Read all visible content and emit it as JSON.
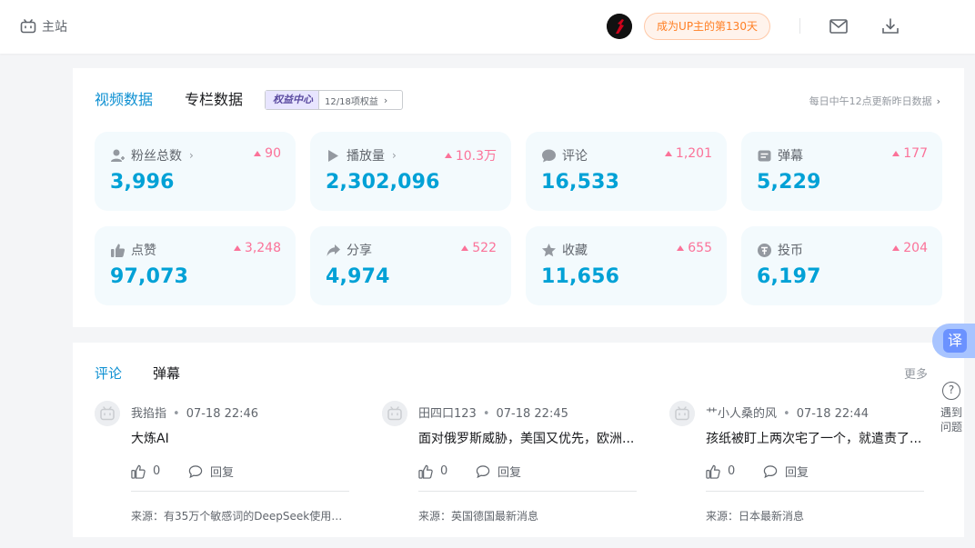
{
  "topbar": {
    "home_label": "主站",
    "up_badge": "成为UP主的第130天"
  },
  "data_panel": {
    "tabs": [
      "视频数据",
      "专栏数据"
    ],
    "equity": {
      "title": "权益中心",
      "progress": "12/18项权益"
    },
    "update_note": "每日中午12点更新昨日数据",
    "cards": [
      {
        "label": "粉丝总数",
        "value": "3,996",
        "delta": "90",
        "icon": "fans-icon",
        "has_chevron": true
      },
      {
        "label": "播放量",
        "value": "2,302,096",
        "delta": "10.3万",
        "icon": "play-icon",
        "has_chevron": true
      },
      {
        "label": "评论",
        "value": "16,533",
        "delta": "1,201",
        "icon": "comment-icon",
        "has_chevron": false
      },
      {
        "label": "弹幕",
        "value": "5,229",
        "delta": "177",
        "icon": "danmaku-icon",
        "has_chevron": false
      },
      {
        "label": "点赞",
        "value": "97,073",
        "delta": "3,248",
        "icon": "thumb-up-icon",
        "has_chevron": false
      },
      {
        "label": "分享",
        "value": "4,974",
        "delta": "522",
        "icon": "share-icon",
        "has_chevron": false
      },
      {
        "label": "收藏",
        "value": "11,656",
        "delta": "655",
        "icon": "star-icon",
        "has_chevron": false
      },
      {
        "label": "投币",
        "value": "6,197",
        "delta": "204",
        "icon": "coin-icon",
        "has_chevron": false
      }
    ]
  },
  "comments_panel": {
    "tabs": [
      "评论",
      "弹幕"
    ],
    "more": "更多",
    "items": [
      {
        "user": "我掐指",
        "time": "07-18 22:46",
        "text": "大炼AI",
        "likes": "0",
        "reply": "回复",
        "source": "来源：有35万个敏感词的DeepSeek使用者..."
      },
      {
        "user": "田四口123",
        "time": "07-18 22:45",
        "text": "面对俄罗斯威胁，美国又优先，欧洲...",
        "likes": "0",
        "reply": "回复",
        "source": "来源：英国德国最新消息"
      },
      {
        "user": "艹小人桑的风",
        "time": "07-18 22:44",
        "text": "孩纸被盯上两次宅了一个，就遣责了...",
        "likes": "0",
        "reply": "回复",
        "source": "来源：日本最新消息"
      }
    ]
  },
  "side_tools": {
    "translate": "译",
    "help": "遇到问题"
  },
  "colors": {
    "accent": "#00a1d6",
    "tab_active": "#0e90d2",
    "delta": "#fb7299",
    "card_bg": "#f3fafd",
    "badge_text": "#ff7f24"
  }
}
